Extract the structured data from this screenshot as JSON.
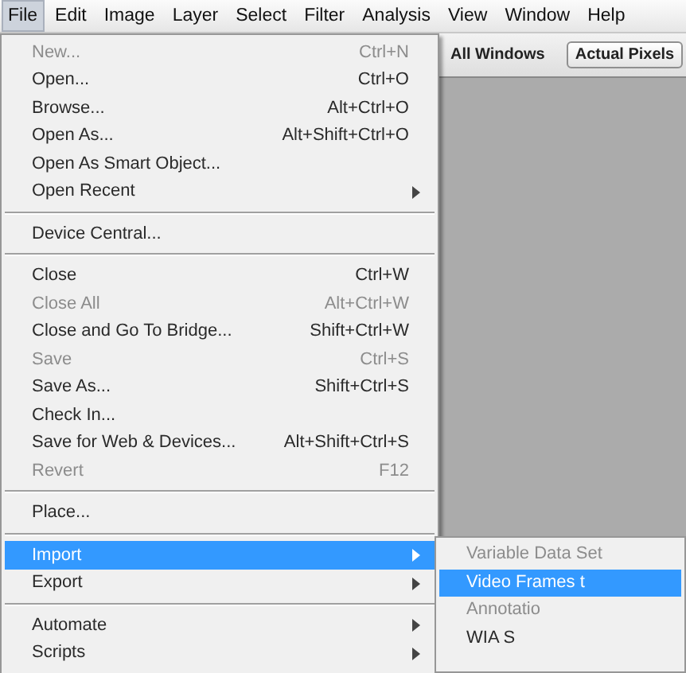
{
  "menubar": [
    {
      "label": "File",
      "selected": true
    },
    {
      "label": "Edit",
      "selected": false
    },
    {
      "label": "Image",
      "selected": false
    },
    {
      "label": "Layer",
      "selected": false
    },
    {
      "label": "Select",
      "selected": false
    },
    {
      "label": "Filter",
      "selected": false
    },
    {
      "label": "Analysis",
      "selected": false
    },
    {
      "label": "View",
      "selected": false
    },
    {
      "label": "Window",
      "selected": false
    },
    {
      "label": "Help",
      "selected": false
    }
  ],
  "toolbar": {
    "option_label": "All Windows",
    "button": "Actual Pixels"
  },
  "file_menu": [
    {
      "kind": "item",
      "label": "New...",
      "shortcut": "Ctrl+N",
      "disabled": true,
      "submenu": false,
      "selected": false
    },
    {
      "kind": "item",
      "label": "Open...",
      "shortcut": "Ctrl+O",
      "disabled": false,
      "submenu": false,
      "selected": false
    },
    {
      "kind": "item",
      "label": "Browse...",
      "shortcut": "Alt+Ctrl+O",
      "disabled": false,
      "submenu": false,
      "selected": false
    },
    {
      "kind": "item",
      "label": "Open As...",
      "shortcut": "Alt+Shift+Ctrl+O",
      "disabled": false,
      "submenu": false,
      "selected": false
    },
    {
      "kind": "item",
      "label": "Open As Smart Object...",
      "disabled": false,
      "submenu": false,
      "selected": false
    },
    {
      "kind": "item",
      "label": "Open Recent",
      "disabled": false,
      "submenu": true,
      "selected": false
    },
    {
      "kind": "separator"
    },
    {
      "kind": "item",
      "label": "Device Central...",
      "disabled": false,
      "submenu": false,
      "selected": false
    },
    {
      "kind": "separator"
    },
    {
      "kind": "item",
      "label": "Close",
      "shortcut": "Ctrl+W",
      "disabled": false,
      "submenu": false,
      "selected": false
    },
    {
      "kind": "item",
      "label": "Close All",
      "shortcut": "Alt+Ctrl+W",
      "disabled": true,
      "submenu": false,
      "selected": false
    },
    {
      "kind": "item",
      "label": "Close and Go To Bridge...",
      "shortcut": "Shift+Ctrl+W",
      "disabled": false,
      "submenu": false,
      "selected": false
    },
    {
      "kind": "item",
      "label": "Save",
      "shortcut": "Ctrl+S",
      "disabled": true,
      "submenu": false,
      "selected": false
    },
    {
      "kind": "item",
      "label": "Save As...",
      "shortcut": "Shift+Ctrl+S",
      "disabled": false,
      "submenu": false,
      "selected": false
    },
    {
      "kind": "item",
      "label": "Check In...",
      "disabled": false,
      "submenu": false,
      "selected": false
    },
    {
      "kind": "item",
      "label": "Save for Web & Devices...",
      "shortcut": "Alt+Shift+Ctrl+S",
      "disabled": false,
      "submenu": false,
      "selected": false
    },
    {
      "kind": "item",
      "label": "Revert",
      "shortcut": "F12",
      "disabled": true,
      "submenu": false,
      "selected": false
    },
    {
      "kind": "separator"
    },
    {
      "kind": "item",
      "label": "Place...",
      "disabled": false,
      "submenu": false,
      "selected": false
    },
    {
      "kind": "separator"
    },
    {
      "kind": "item",
      "label": "Import",
      "disabled": false,
      "submenu": true,
      "selected": true
    },
    {
      "kind": "item",
      "label": "Export",
      "disabled": false,
      "submenu": true,
      "selected": false
    },
    {
      "kind": "separator"
    },
    {
      "kind": "item",
      "label": "Automate",
      "disabled": false,
      "submenu": true,
      "selected": false
    },
    {
      "kind": "item",
      "label": "Scripts",
      "disabled": false,
      "submenu": true,
      "selected": false
    }
  ],
  "import_submenu": [
    {
      "label": "Variable Data Set",
      "disabled": true,
      "selected": false
    },
    {
      "label": "Video Frames t",
      "disabled": false,
      "selected": true
    },
    {
      "label": "Annotatio",
      "disabled": true,
      "selected": false
    },
    {
      "label": "WIA S",
      "disabled": false,
      "selected": false
    }
  ]
}
